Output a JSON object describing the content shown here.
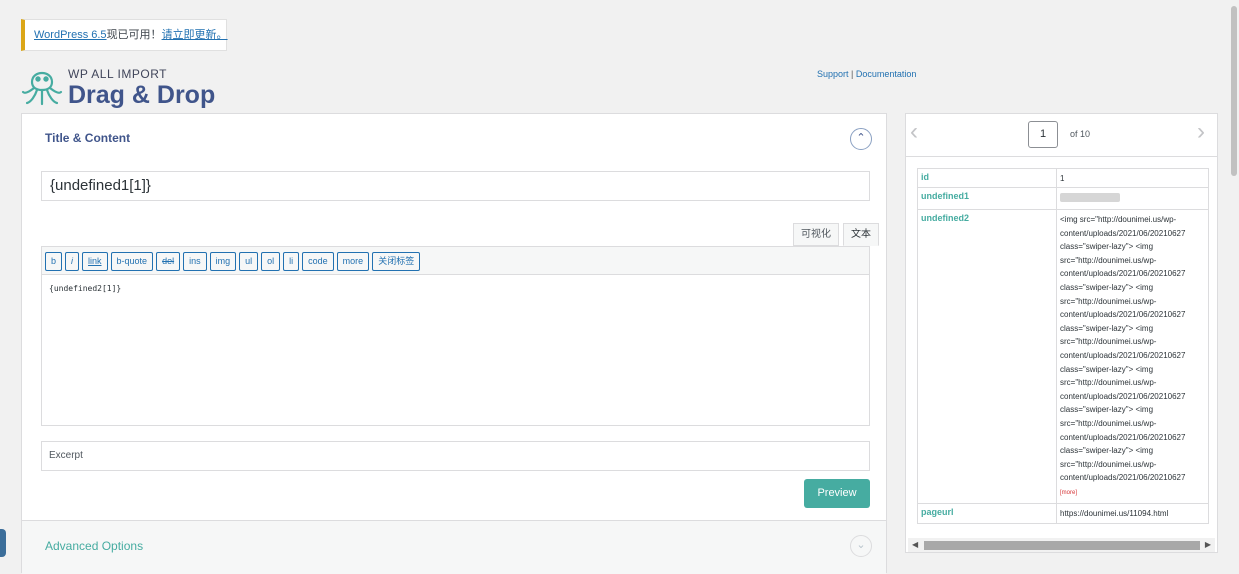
{
  "notice": {
    "update_link": "WordPress 6.5",
    "middle_text": "现已可用！",
    "action_link": "请立即更新。"
  },
  "brand": {
    "small": "WP ALL IMPORT",
    "big": "Drag & Drop"
  },
  "help": {
    "support": "Support",
    "separator": " | ",
    "documentation": "Documentation"
  },
  "title_content": {
    "heading": "Title & Content",
    "collapse_icon": "chevron-up-icon",
    "title_value": "{undefined1[1]}",
    "editor_tabs": [
      "可视化",
      "文本"
    ],
    "toolbar": [
      "b",
      "i",
      "link",
      "b-quote",
      "del",
      "ins",
      "img",
      "ul",
      "ol",
      "li",
      "code",
      "more",
      "关闭标签"
    ],
    "editor_value": "{undefined2[1]}",
    "excerpt_placeholder": "Excerpt",
    "preview_label": "Preview"
  },
  "advanced": {
    "heading": "Advanced Options",
    "expand_icon": "chevron-down-icon"
  },
  "record_viewer": {
    "prev_icon": "chevron-left-icon",
    "next_icon": "chevron-right-icon",
    "current_page": "1",
    "of_label": "of 10",
    "rows": {
      "id": {
        "key": "id",
        "value": "1"
      },
      "undefined1": {
        "key": "undefined1"
      },
      "undefined2": {
        "key": "undefined2",
        "value": "<img src=\"http://dounimei.us/wp-\ncontent/uploads/2021/06/20210627\nclass=\"swiper-lazy\"> <img\nsrc=\"http://dounimei.us/wp-\ncontent/uploads/2021/06/20210627\nclass=\"swiper-lazy\"> <img\nsrc=\"http://dounimei.us/wp-\ncontent/uploads/2021/06/20210627\nclass=\"swiper-lazy\"> <img\nsrc=\"http://dounimei.us/wp-\ncontent/uploads/2021/06/20210627\nclass=\"swiper-lazy\"> <img\nsrc=\"http://dounimei.us/wp-\ncontent/uploads/2021/06/20210627\nclass=\"swiper-lazy\"> <img\nsrc=\"http://dounimei.us/wp-\ncontent/uploads/2021/06/20210627\nclass=\"swiper-lazy\"> <img\nsrc=\"http://dounimei.us/wp-\ncontent/uploads/2021/06/20210627",
        "more": "[more]"
      },
      "pageurl": {
        "key": "pageurl",
        "value": "https://dounimei.us/11094.html"
      }
    }
  },
  "colors": {
    "accent": "#46aca1",
    "brand": "#40558b",
    "link": "#2271b1"
  }
}
